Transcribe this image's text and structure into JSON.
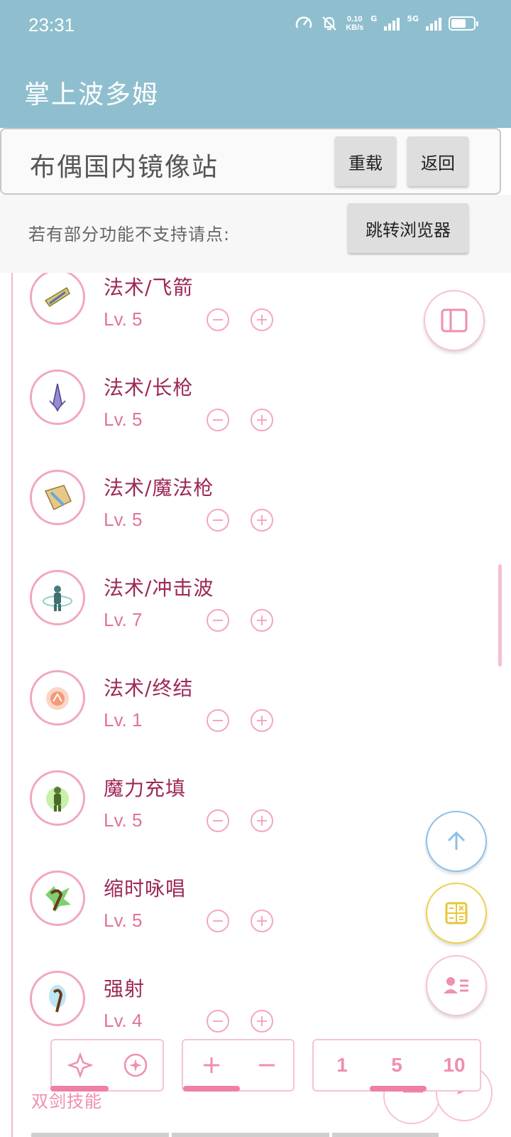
{
  "status_bar": {
    "time": "23:31",
    "net_speed_value": "0.10",
    "net_speed_unit": "KB/s",
    "signal_1_label": "G",
    "signal_2_label": "5G",
    "icons": [
      "speedometer-icon",
      "bell-off-icon",
      "signal-icon",
      "battery-icon"
    ]
  },
  "app": {
    "title": "掌上波多姆"
  },
  "mirror_bar": {
    "title": "布偶国内镜像站",
    "reload_label": "重载",
    "back_label": "返回"
  },
  "notice": {
    "text": "若有部分功能不支持请点:",
    "button_label": "跳转浏览器"
  },
  "skills": [
    {
      "name": "法术/飞箭",
      "level": "Lv. 5",
      "icon": "arrow-spell-icon"
    },
    {
      "name": "法术/长枪",
      "level": "Lv. 5",
      "icon": "spear-spell-icon"
    },
    {
      "name": "法术/魔法枪",
      "level": "Lv. 5",
      "icon": "magic-spear-icon"
    },
    {
      "name": "法术/冲击波",
      "level": "Lv. 7",
      "icon": "shockwave-icon"
    },
    {
      "name": "法术/终结",
      "level": "Lv. 1",
      "icon": "finale-icon"
    },
    {
      "name": "魔力充填",
      "level": "Lv. 5",
      "icon": "mana-charge-icon"
    },
    {
      "name": "缩时咏唱",
      "level": "Lv. 5",
      "icon": "quick-chant-icon"
    },
    {
      "name": "强射",
      "level": "Lv. 4",
      "icon": "power-shot-icon"
    }
  ],
  "bottom_bar": {
    "step_options": [
      "1",
      "5",
      "10"
    ],
    "section_label": "双剑技能"
  },
  "colors": {
    "header": "#8fbfcf",
    "accent_pink": "#f07fa6",
    "skill_name": "#9c2858",
    "fab_blue": "#8cc0ea",
    "fab_yellow": "#f0d04a"
  }
}
